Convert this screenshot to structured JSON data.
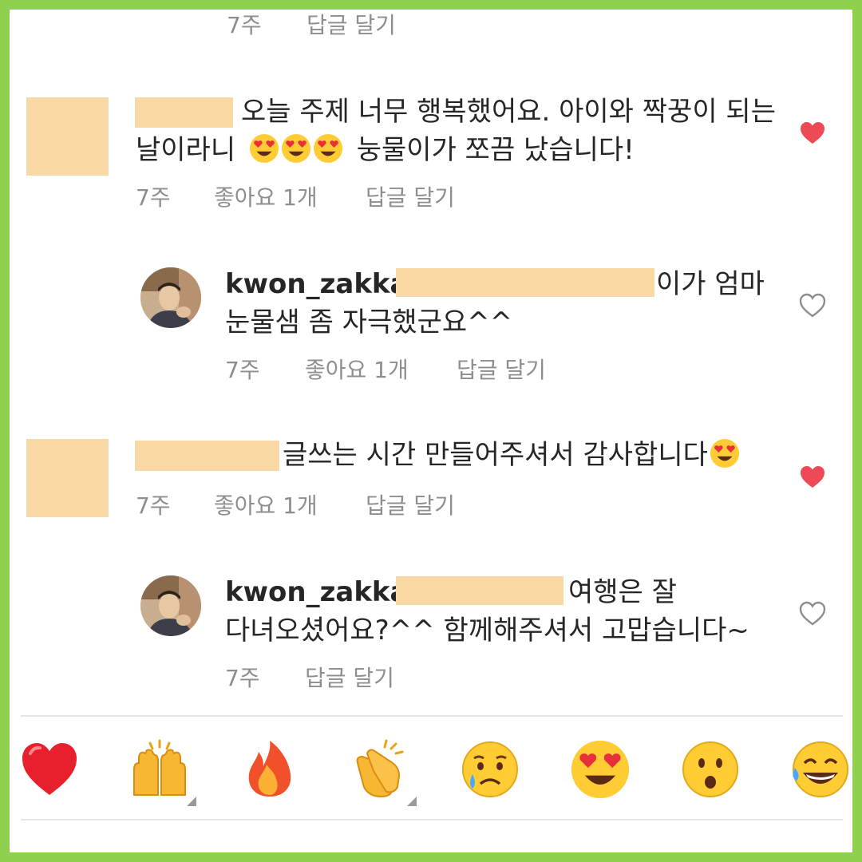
{
  "top_partial": {
    "time": "7주",
    "reply": "답글 달기"
  },
  "comments": [
    {
      "line1": "오늘 주제 너무 행복했어요. 아이와 짝꿍이 되는",
      "line2_a": "날이라니",
      "line2_b": "눙물이가 쪼끔 났습니다!",
      "time": "7주",
      "likes": "좋아요 1개",
      "reply": "답글 달기",
      "liked": true
    },
    {
      "username": "kwon_zakka",
      "line1_tail": "이가 엄마",
      "line2": "눈물샘 좀 자극했군요^^",
      "time": "7주",
      "likes": "좋아요 1개",
      "reply": "답글 달기",
      "liked": false
    },
    {
      "line1": "글쓰는 시간 만들어주셔서 감사합니다",
      "time": "7주",
      "likes": "좋아요 1개",
      "reply": "답글 달기",
      "liked": true
    },
    {
      "username": "kwon_zakka",
      "line1_tail": "여행은 잘",
      "line2": "다녀오셨어요?^^ 함께해주셔서 고맙습니다~",
      "time": "7주",
      "reply": "답글 달기",
      "liked": false
    }
  ],
  "quick_reactions": [
    {
      "name": "red-heart-icon"
    },
    {
      "name": "raising-hands-icon",
      "has_variants": true
    },
    {
      "name": "fire-icon"
    },
    {
      "name": "clapping-hands-icon",
      "has_variants": true
    },
    {
      "name": "crying-face-icon"
    },
    {
      "name": "heart-eyes-face-icon"
    },
    {
      "name": "surprised-face-icon"
    },
    {
      "name": "tears-of-joy-face-icon"
    }
  ],
  "colors": {
    "frame_border": "#8fd14f",
    "redaction": "#f8d8a5",
    "like_red": "#ed4956",
    "meta_gray": "#8e8e8e",
    "text": "#262626"
  }
}
